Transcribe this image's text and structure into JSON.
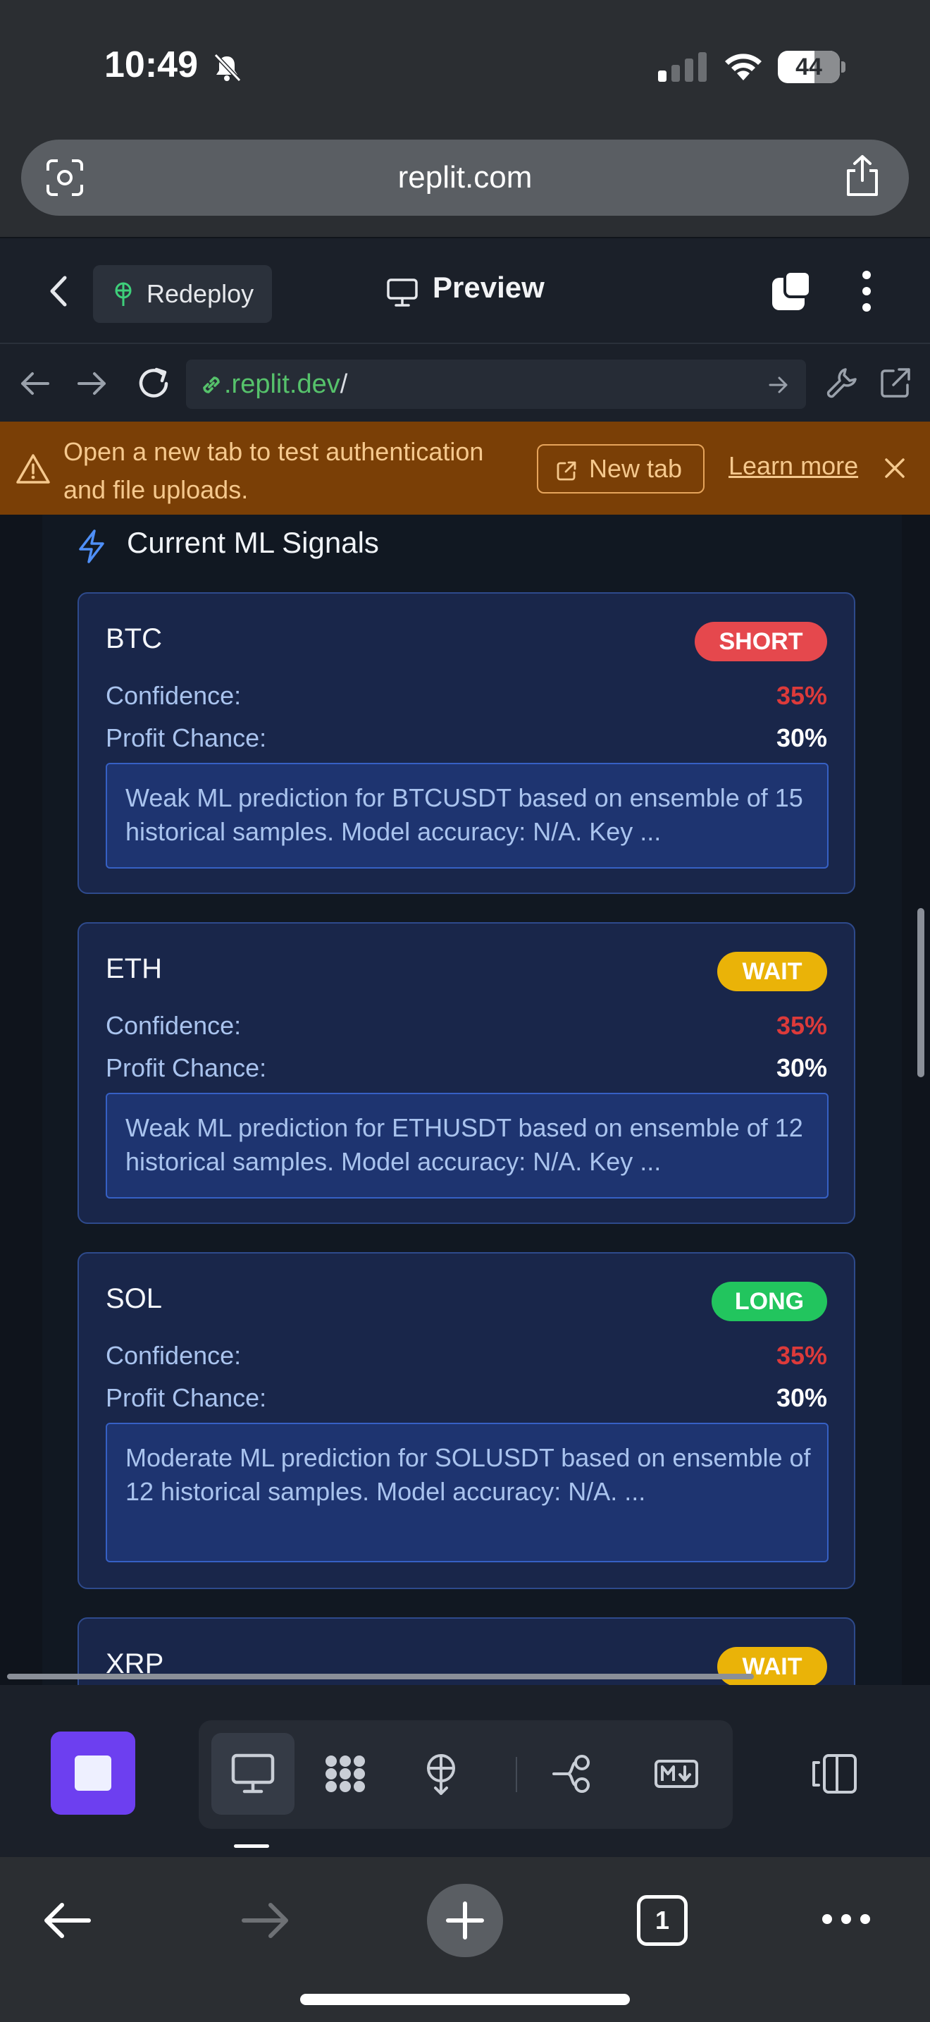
{
  "status_bar": {
    "time": "10:49",
    "battery": "44"
  },
  "browser": {
    "url": "replit.com"
  },
  "app_header": {
    "redeploy_label": "Redeploy",
    "preview_label": "Preview"
  },
  "webview": {
    "address_domain": ".replit.dev",
    "address_path": "/"
  },
  "banner": {
    "message": "Open a new tab to test authentication and file uploads.",
    "new_tab_label": "New tab",
    "learn_more_label": "Learn more"
  },
  "section": {
    "title": "Current ML Signals"
  },
  "labels": {
    "confidence": "Confidence:",
    "profit_chance": "Profit Chance:"
  },
  "signals": [
    {
      "coin": "BTC",
      "signal": "SHORT",
      "confidence": "35%",
      "profit_chance": "30%",
      "description": "Weak ML prediction for BTCUSDT based on ensemble of 15 historical samples. Model accuracy: N/A. Key ..."
    },
    {
      "coin": "ETH",
      "signal": "WAIT",
      "confidence": "35%",
      "profit_chance": "30%",
      "description": "Weak ML prediction for ETHUSDT based on ensemble of 12 historical samples. Model accuracy: N/A. Key ..."
    },
    {
      "coin": "SOL",
      "signal": "LONG",
      "confidence": "35%",
      "profit_chance": "30%",
      "description": "Moderate ML prediction for SOLUSDT based on ensemble of 12 historical samples. Model accuracy: N/A. ..."
    },
    {
      "coin": "XRP",
      "signal": "WAIT"
    }
  ],
  "signal_colors": {
    "SHORT": "#e5484d",
    "WAIT": "#eab308",
    "LONG": "#22c55e"
  },
  "bottom_bar": {
    "tab_count": "1"
  }
}
